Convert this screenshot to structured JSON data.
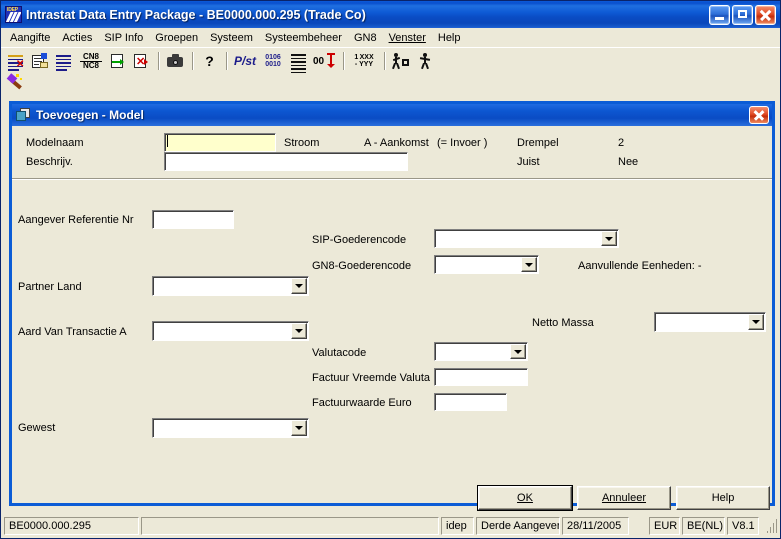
{
  "window": {
    "title": "Intrastat Data Entry Package - BE0000.000.295 (Trade Co)",
    "app_icon": "idep-icon",
    "icon_label": "IDEP",
    "buttons": {
      "minimize": "minimize-button",
      "maximize": "maximize-button",
      "close": "close-button"
    }
  },
  "menubar": {
    "items": [
      {
        "label": "Aangifte"
      },
      {
        "label": "Acties"
      },
      {
        "label": "SIP Info"
      },
      {
        "label": "Groepen"
      },
      {
        "label": "Systeem"
      },
      {
        "label": "Systeembeheer"
      },
      {
        "label": "GN8"
      },
      {
        "label": "Venster",
        "accel": "V"
      },
      {
        "label": "Help"
      }
    ]
  },
  "toolbar": {
    "buttons": [
      {
        "name": "new-declaration-icon"
      },
      {
        "name": "edit-declaration-icon"
      },
      {
        "name": "list-icon"
      },
      {
        "name": "cn8-nc8-icon",
        "text_top": "CN8",
        "text_bottom": "NC8"
      },
      {
        "name": "import-document-icon"
      },
      {
        "name": "delete-document-icon"
      },
      {
        "name": "camera-icon"
      },
      {
        "name": "help-question-icon",
        "glyph": "?"
      },
      {
        "name": "pst-icon",
        "text": "P/st"
      },
      {
        "name": "binary-data-icon",
        "text_top": "0106",
        "text_bottom": "0010"
      },
      {
        "name": "lines-icon"
      },
      {
        "name": "numeric-updown-icon",
        "text": "00"
      },
      {
        "name": "date-format-icon",
        "text_top": "1 XXX",
        "text_bottom": "- YYY"
      },
      {
        "name": "person-box-icon"
      },
      {
        "name": "person-icon"
      },
      {
        "name": "wizard-wand-icon"
      }
    ]
  },
  "dialog": {
    "title": "Toevoegen - Model",
    "icon": "model-window-icon",
    "close_button": "dialog-close-button",
    "header": {
      "modelnaam_label": "Modelnaam",
      "modelnaam_value": "",
      "beschrijv_label": "Beschrijv.",
      "beschrijv_value": "",
      "stroom_label": "Stroom",
      "stroom_value": "A - Aankomst",
      "stroom_note": "(= Invoer )",
      "drempel_label": "Drempel",
      "drempel_value": "2",
      "juist_label": "Juist",
      "juist_value": "Nee"
    },
    "fields": {
      "aangever_referentie_label": "Aangever Referentie Nr",
      "aangever_referentie_value": "",
      "sip_goederencode_label": "SIP-Goederencode",
      "sip_goederencode_value": "",
      "gn8_goederencode_label": "GN8-Goederencode",
      "gn8_goederencode_value": "",
      "aanvullende_eenheden_label": "Aanvullende Eenheden: -",
      "partner_land_label": "Partner Land",
      "partner_land_value": "",
      "aard_van_transactie_label": "Aard Van Transactie A",
      "aard_van_transactie_value": "",
      "netto_massa_label": "Netto Massa",
      "netto_massa_value": "",
      "valutacode_label": "Valutacode",
      "valutacode_value": "",
      "factuur_vreemde_valuta_label": "Factuur Vreemde Valuta",
      "factuur_vreemde_valuta_value": "",
      "factuurwaarde_euro_label": "Factuurwaarde Euro",
      "factuurwaarde_euro_value": "",
      "gewest_label": "Gewest",
      "gewest_value": ""
    },
    "buttons": {
      "ok": "OK",
      "ok_accel": "O",
      "cancel": "Annuleer",
      "cancel_accel": "A",
      "help": "Help"
    }
  },
  "statusbar": {
    "company_id": "BE0000.000.295",
    "spacer": "",
    "mode": "idep",
    "role": "Derde Aangever",
    "date": "28/11/2005",
    "currency": "EUR",
    "locale": "BE(NL)",
    "version": "V8.1"
  },
  "colors": {
    "titlebar_blue": "#0a4cc4",
    "window_face": "#ece9d8",
    "focus_field": "#ffffcc",
    "close_red": "#c32d0b"
  }
}
